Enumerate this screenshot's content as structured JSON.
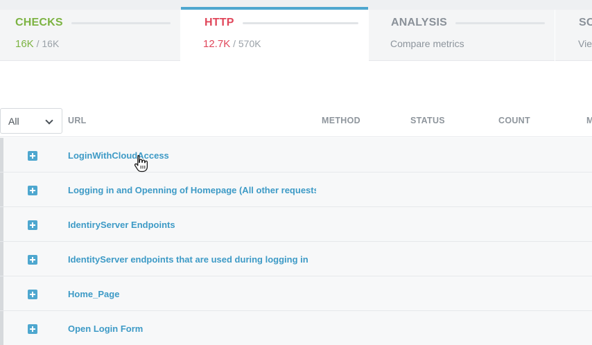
{
  "tabs": [
    {
      "title": "CHECKS",
      "primary": "16K",
      "separator": "/",
      "secondary": "16K",
      "color": "#7cb342"
    },
    {
      "title": "HTTP",
      "primary": "12.7K",
      "separator": "/",
      "secondary": "570K",
      "color": "#e0465a"
    },
    {
      "title": "ANALYSIS",
      "subtitle": "Compare metrics",
      "color": "#8a9199"
    },
    {
      "title": "SC",
      "subtitle": "Vie",
      "color": "#8a9199"
    }
  ],
  "filter": {
    "value": "All"
  },
  "columns": {
    "url": "URL",
    "method": "METHOD",
    "status": "STATUS",
    "count": "COUNT",
    "more": "M"
  },
  "rows": [
    {
      "label": "LoginWithCloudAccess"
    },
    {
      "label": "Logging in and Openning of Homepage (All other requests or"
    },
    {
      "label": "IdentiryServer Endpoints"
    },
    {
      "label": "IdentityServer endpoints that are used during logging in"
    },
    {
      "label": "Home_Page"
    },
    {
      "label": "Open Login Form"
    }
  ],
  "accent_color": "#4ea7cf"
}
